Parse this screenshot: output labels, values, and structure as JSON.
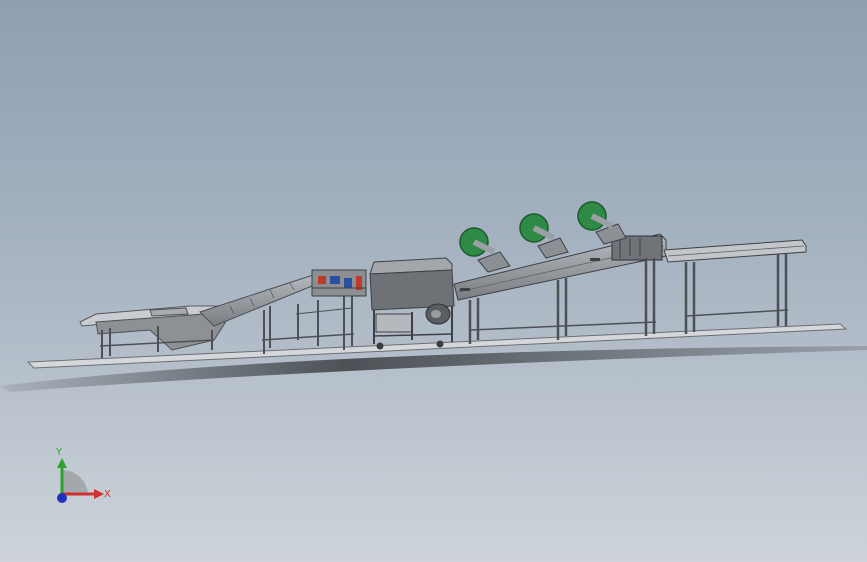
{
  "viewport": {
    "background_top": "#8f9fb2",
    "background_bottom": "#cdd3d9"
  },
  "model": {
    "frame_color": "#5a5e63",
    "steel_color": "#9a9ea3",
    "fan_color": "#2f8a45",
    "accent_red": "#c0392b",
    "accent_blue": "#2a4fa0"
  },
  "triad": {
    "y_label": "Y",
    "x_label": "X",
    "x_color": "#d03030",
    "y_color": "#30a030",
    "z_color": "#2030c0"
  }
}
